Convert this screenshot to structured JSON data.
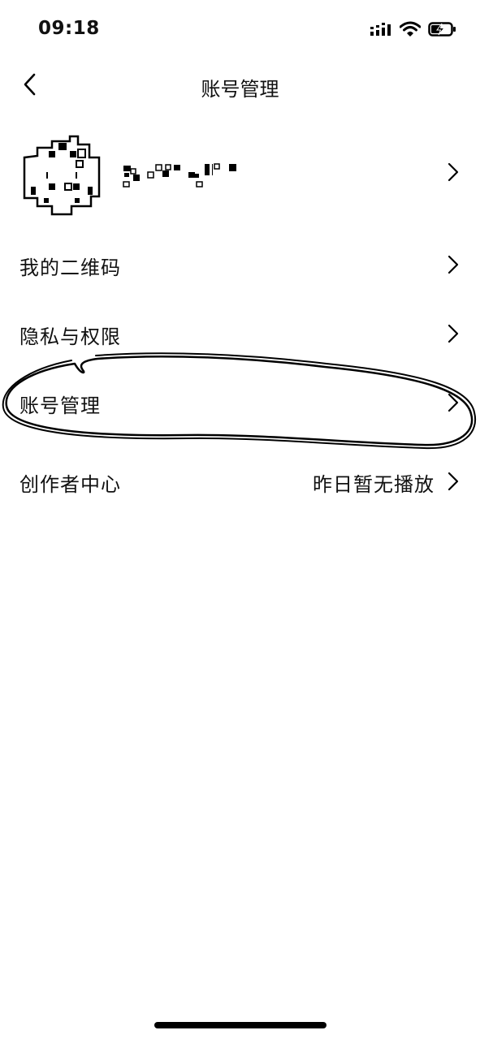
{
  "status_bar": {
    "time": "09:18",
    "icons": [
      "cellular-signal-icon",
      "wifi-icon",
      "battery-charging-icon"
    ]
  },
  "nav": {
    "title": "账号管理",
    "back_icon": "chevron-left-icon"
  },
  "profile": {
    "avatar": "pixel-avatar",
    "username_obscured": true
  },
  "menu": [
    {
      "label": "我的二维码",
      "value": ""
    },
    {
      "label": "隐私与权限",
      "value": ""
    },
    {
      "label": "账号管理",
      "value": "",
      "circled": true
    },
    {
      "label": "创作者中心",
      "value": "昨日暂无播放"
    }
  ],
  "colors": {
    "background": "#ffffff",
    "text": "#111111",
    "annotation": "#000000"
  }
}
